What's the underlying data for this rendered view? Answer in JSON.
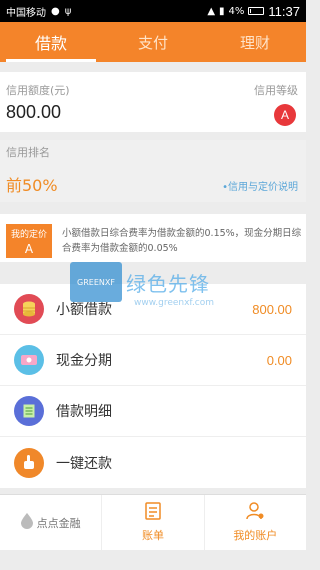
{
  "status_bar": {
    "carrier": "中国移动",
    "battery": "4%",
    "time": "11:37"
  },
  "tabs": [
    {
      "label": "借款",
      "active": true
    },
    {
      "label": "支付",
      "active": false
    },
    {
      "label": "理财",
      "active": false
    }
  ],
  "credit": {
    "label": "信用额度(元)",
    "amount": "800.00",
    "level_label": "信用等级",
    "level": "A"
  },
  "ranking": {
    "label": "信用排名",
    "value": "前50%",
    "link": "•信用与定价说明"
  },
  "rate": {
    "tag_label": "我的定价",
    "tag_value": "A",
    "text": "小额借款日综合费率为借款金额的0.15%，现金分期日综合费率为借款金额的0.05%"
  },
  "watermark": {
    "logo_text": "GREENXF",
    "title": "绿色先锋",
    "url": "www.greenxf.com"
  },
  "menu": [
    {
      "label": "小额借款",
      "value": "800.00",
      "icon": "coins-icon",
      "color": "#e14b55"
    },
    {
      "label": "现金分期",
      "value": "0.00",
      "icon": "ticket-icon",
      "color": "#5bbfe6"
    },
    {
      "label": "借款明细",
      "value": "",
      "icon": "list-icon",
      "color": "#5a6fd8"
    },
    {
      "label": "一键还款",
      "value": "",
      "icon": "hand-icon",
      "color": "#f0882a"
    }
  ],
  "bottom_bar": {
    "brand": "点点金融",
    "tabs": [
      {
        "label": "账单",
        "icon": "bill-icon"
      },
      {
        "label": "我的账户",
        "icon": "user-icon"
      }
    ]
  },
  "colors": {
    "accent": "#f4842a",
    "value_orange": "#f08c25",
    "level_red": "#e8383b"
  }
}
